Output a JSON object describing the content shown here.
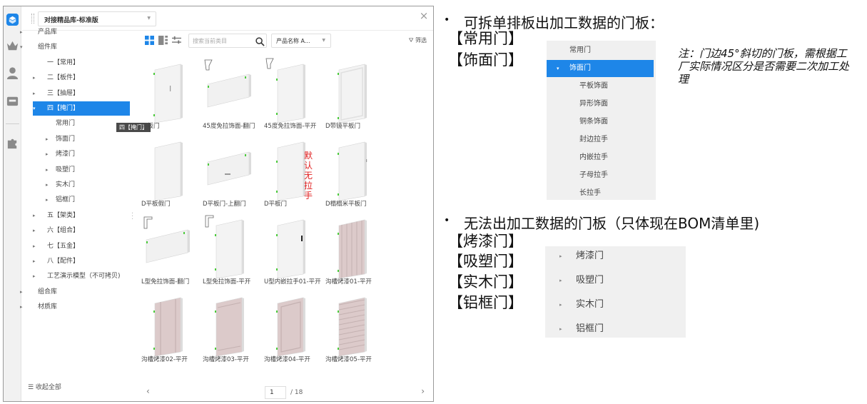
{
  "app": {
    "library": "对接精品库-标准版",
    "tree": [
      {
        "label": "产品库",
        "level": 0,
        "arrow": "▸"
      },
      {
        "label": "组件库",
        "level": 0,
        "arrow": "▾"
      },
      {
        "label": "一【常用】",
        "level": 1,
        "arrow": ""
      },
      {
        "label": "二【板件】",
        "level": 1,
        "arrow": "▸"
      },
      {
        "label": "三【抽屉】",
        "level": 1,
        "arrow": "▸"
      },
      {
        "label": "四【掩门】",
        "level": 1,
        "arrow": "▾",
        "active": true
      },
      {
        "label": "常用门",
        "level": 2,
        "arrow": ""
      },
      {
        "label": "饰面门",
        "level": 2,
        "arrow": "▸"
      },
      {
        "label": "烤漆门",
        "level": 2,
        "arrow": "▸"
      },
      {
        "label": "吸塑门",
        "level": 2,
        "arrow": "▸"
      },
      {
        "label": "实木门",
        "level": 2,
        "arrow": "▸"
      },
      {
        "label": "铝框门",
        "level": 2,
        "arrow": "▸"
      },
      {
        "label": "五【架类】",
        "level": 1,
        "arrow": "▸"
      },
      {
        "label": "六【组合】",
        "level": 1,
        "arrow": "▸"
      },
      {
        "label": "七【五金】",
        "level": 1,
        "arrow": "▸"
      },
      {
        "label": "八【配件】",
        "level": 1,
        "arrow": "▸"
      },
      {
        "label": "工艺演示模型（不可拷贝)",
        "level": 1,
        "arrow": "▸"
      },
      {
        "label": "组合库",
        "level": 0,
        "arrow": "▸"
      },
      {
        "label": "材质库",
        "level": 0,
        "arrow": "▸"
      }
    ],
    "tooltip": "四【掩门】",
    "collapse_all": "☰ 收起全部",
    "search_placeholder": "搜索当前类目",
    "sort_label": "产品名称 A...",
    "filter_label": "筛选",
    "items": [
      {
        "caption": "平板门",
        "kind": "plain"
      },
      {
        "caption": "45度免拉饰面-翻门",
        "kind": "lift"
      },
      {
        "caption": "45度免拉饰面-平开",
        "kind": "bevel"
      },
      {
        "caption": "D带镜平板门",
        "kind": "mirror"
      },
      {
        "caption": "D平板假门",
        "kind": "plain2"
      },
      {
        "caption": "D平板门-上翻门",
        "kind": "lifthandle"
      },
      {
        "caption": "D平板门",
        "kind": "plainred"
      },
      {
        "caption": "D榻榻米平板门",
        "kind": "tatami"
      },
      {
        "caption": "L型免拉饰面-翻门",
        "kind": "llift"
      },
      {
        "caption": "L型免拉饰面-平开",
        "kind": "lbevel"
      },
      {
        "caption": "U型内嵌拉手01-平开",
        "kind": "uhandle"
      },
      {
        "caption": "沟槽烤漆01-平开",
        "kind": "groove1"
      },
      {
        "caption": "沟槽烤漆02-平开",
        "kind": "groove2"
      },
      {
        "caption": "沟槽烤漆03-平开",
        "kind": "groove3"
      },
      {
        "caption": "沟槽烤漆04-平开",
        "kind": "groove4"
      },
      {
        "caption": "沟槽烤漆05-平开",
        "kind": "groove5"
      }
    ],
    "red_annotation": "默认无拉手",
    "page_current": "1",
    "page_total": "/ 18"
  },
  "annotation": {
    "heading1": "可拆单排板出加工数据的门板：",
    "cats1": [
      "【常用门】",
      "【饰面门】"
    ],
    "menu1": [
      {
        "label": "常用门",
        "arrow": ""
      },
      {
        "label": "饰面门",
        "arrow": "▾",
        "selected": true
      },
      {
        "label": "平板饰面",
        "arrow": ""
      },
      {
        "label": "异形饰面",
        "arrow": ""
      },
      {
        "label": "铜条饰面",
        "arrow": ""
      },
      {
        "label": "封边拉手",
        "arrow": ""
      },
      {
        "label": "内嵌拉手",
        "arrow": ""
      },
      {
        "label": "子母拉手",
        "arrow": ""
      },
      {
        "label": "长拉手",
        "arrow": ""
      }
    ],
    "note": "注：门边45°斜切的门板，需根据工厂实际情况区分是否需要二次加工处理",
    "heading2": "无法出加工数据的门板（只体现在BOM清单里)",
    "cats2": [
      "【烤漆门】",
      "【吸塑门】",
      "【实木门】",
      "【铝框门】"
    ],
    "menu2": [
      {
        "label": "烤漆门",
        "arrow": "▸"
      },
      {
        "label": "吸塑门",
        "arrow": "▸"
      },
      {
        "label": "实木门",
        "arrow": "▸"
      },
      {
        "label": "铝框门",
        "arrow": "▸"
      }
    ]
  },
  "colors": {
    "accent": "#1e86e8",
    "red": "#e02020",
    "door": "#f2f2f2",
    "lacquer": "#d9c7c7"
  }
}
